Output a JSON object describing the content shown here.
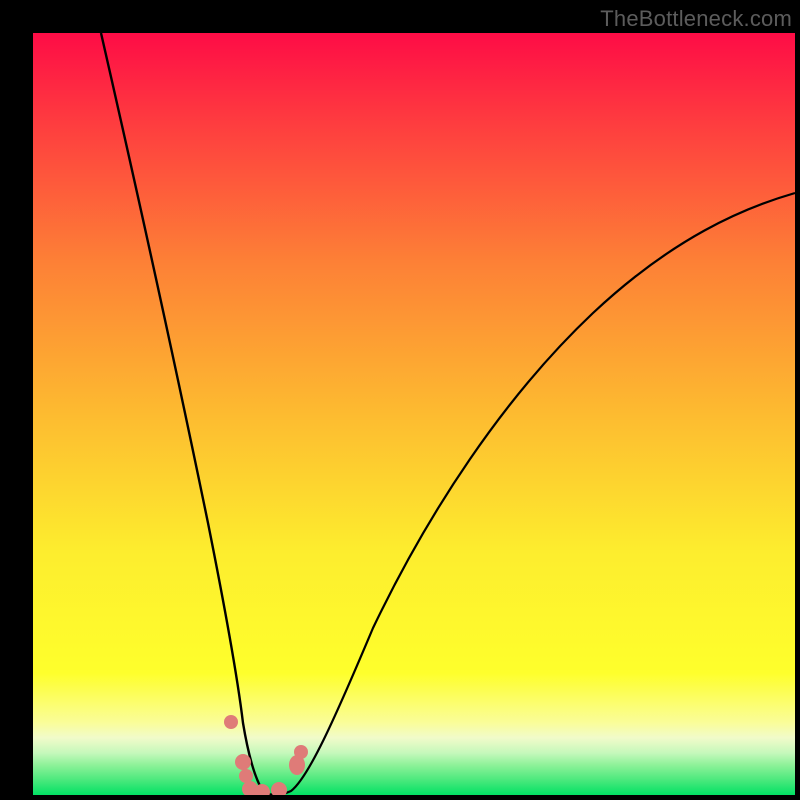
{
  "attribution": "TheBottleneck.com",
  "chart_data": {
    "type": "line",
    "title": "",
    "xlabel": "",
    "ylabel": "",
    "xlim": [
      0,
      100
    ],
    "ylim": [
      0,
      100
    ],
    "grid": false,
    "legend": false,
    "series": [
      {
        "name": "bottleneck-curve-left",
        "color": "#000000",
        "x": [
          9.0,
          12.0,
          15.0,
          19.0,
          22.0,
          25.0,
          26.5,
          27.5,
          28.5,
          29.5,
          30.5
        ],
        "y": [
          100.0,
          80.0,
          60.0,
          40.0,
          25.0,
          12.0,
          6.0,
          3.0,
          1.0,
          0.3,
          0.0
        ]
      },
      {
        "name": "bottleneck-curve-right",
        "color": "#000000",
        "x": [
          31.0,
          32.0,
          33.0,
          34.0,
          35.5,
          38.0,
          42.0,
          48.0,
          56.0,
          68.0,
          82.0,
          100.0
        ],
        "y": [
          0.0,
          0.3,
          1.0,
          2.5,
          5.0,
          10.0,
          18.0,
          30.0,
          42.0,
          56.0,
          68.0,
          78.0
        ]
      }
    ],
    "dots": {
      "name": "pink-markers",
      "color": "#df7b78",
      "points": [
        {
          "x": 26.1,
          "y": 9.6
        },
        {
          "x": 27.7,
          "y": 4.3
        },
        {
          "x": 28.0,
          "y": 2.5
        },
        {
          "x": 28.5,
          "y": 0.7
        },
        {
          "x": 30.0,
          "y": 0.4
        },
        {
          "x": 32.3,
          "y": 0.6
        },
        {
          "x": 34.5,
          "y": 4.0
        },
        {
          "x": 35.0,
          "y": 5.6
        }
      ]
    },
    "gradient_bands": [
      {
        "name": "red-top",
        "y0": 100.0,
        "y1": 70.0,
        "color_top": "#fe0c46",
        "color_bot": "#fd8036"
      },
      {
        "name": "orange-mid",
        "y0": 70.0,
        "y1": 35.0,
        "color_top": "#fd8036",
        "color_bot": "#fded2e"
      },
      {
        "name": "yellow-low",
        "y0": 35.0,
        "y1": 10.0,
        "color_top": "#fded2e",
        "color_bot": "#feff2c"
      },
      {
        "name": "pale-band",
        "y0": 10.0,
        "y1": 6.0,
        "color_top": "#fafd99",
        "color_bot": "#f1fbca"
      },
      {
        "name": "green-bottom",
        "y0": 6.0,
        "y1": 0.0,
        "color_top": "#90f29a",
        "color_bot": "#02e164"
      }
    ]
  }
}
